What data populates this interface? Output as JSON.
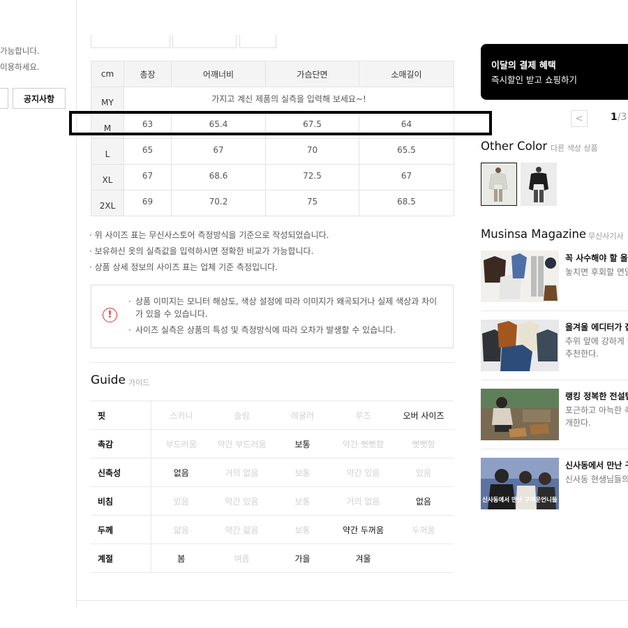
{
  "left_panel": {
    "note_line1": "가능합니다.",
    "note_line2": "이용하세요.",
    "notice_button": "공지사항"
  },
  "size_table": {
    "headers": [
      "cm",
      "총장",
      "어깨너비",
      "가슴단면",
      "소매길이"
    ],
    "my_label": "MY",
    "my_prompt": "가지고 계신 제품의 실측을 입력해 보세요~!",
    "rows": [
      {
        "size": "M",
        "values": [
          "63",
          "65.4",
          "67.5",
          "64"
        ]
      },
      {
        "size": "L",
        "values": [
          "65",
          "67",
          "70",
          "65.5"
        ]
      },
      {
        "size": "XL",
        "values": [
          "67",
          "68.6",
          "72.5",
          "67"
        ]
      },
      {
        "size": "2XL",
        "values": [
          "69",
          "70.2",
          "75",
          "68.5"
        ]
      }
    ],
    "highlighted_row": "M"
  },
  "bullets": [
    "위 사이즈 표는 무신사스토어 측정방식을 기준으로 작성되었습니다.",
    "보유하신 옷의 실측값을 입력하시면 정확한 비교가 가능합니다.",
    "상품 상세 정보의 사이즈 표는 업체 기준 측정입니다."
  ],
  "notice": {
    "icon": "exclamation-circle-icon",
    "icon_glyph": "!",
    "items": [
      "상품 이미지는 모니터 해상도, 색상 설정에 따라 이미지가 왜곡되거나 실제 색상과 차이가 있을 수 있습니다.",
      "사이즈 실측은 상품의 특성 및 측정방식에 따라 오차가 발생할 수 있습니다."
    ]
  },
  "guide": {
    "title": "Guide",
    "subtitle": "가이드",
    "rows": [
      {
        "label": "핏",
        "options": [
          "스키니",
          "슬림",
          "레귤러",
          "루즈",
          "오버 사이즈"
        ],
        "selected": [
          4
        ]
      },
      {
        "label": "촉감",
        "options": [
          "부드러움",
          "약간 부드러움",
          "보통",
          "약간 뻣뻣함",
          "뻣뻣함"
        ],
        "selected": [
          2
        ]
      },
      {
        "label": "신축성",
        "options": [
          "없음",
          "거의 없음",
          "보통",
          "약간 있음",
          "있음"
        ],
        "selected": [
          0
        ]
      },
      {
        "label": "비침",
        "options": [
          "있음",
          "약간 있음",
          "보통",
          "거의 없음",
          "없음"
        ],
        "selected": [
          4
        ]
      },
      {
        "label": "두께",
        "options": [
          "얇음",
          "약간 얇음",
          "보통",
          "약간 두꺼움",
          "두꺼움"
        ],
        "selected": [
          3
        ]
      },
      {
        "label": "계절",
        "options": [
          "봄",
          "여름",
          "가을",
          "겨울",
          ""
        ],
        "selected": [
          0,
          2,
          3
        ]
      }
    ]
  },
  "benefit_banner": {
    "title": "이달의 결제 혜택",
    "subtitle": "즉시할인 받고 쇼핑하기",
    "background": "#000000"
  },
  "pager": {
    "prev_icon": "chevron-left-icon",
    "prev_glyph": "<",
    "current": "1",
    "separator": "/",
    "total": "3"
  },
  "other_color": {
    "title": "Other Color",
    "subtitle": "다른 색상 상품",
    "items": [
      {
        "name": "light-gray-jacket",
        "color": "#d9dbd5",
        "selected": true
      },
      {
        "name": "black-jacket",
        "color": "#1e1e1e",
        "selected": false
      }
    ]
  },
  "magazine": {
    "title": "Musinsa Magazine",
    "subtitle": "무신사기사",
    "articles": [
      {
        "title": "꼭 사수해야 할 올해",
        "desc": [
          "놓치면 후회할 연말"
        ]
      },
      {
        "title": "올겨울 에디터가 잡",
        "desc": [
          "추위 앞에 강하게 맞",
          "추천한다."
        ]
      },
      {
        "title": "랭킹 정복한 전설템",
        "desc": [
          "포근하고 아늑한 촉",
          "개한다."
        ]
      },
      {
        "title": "신사동에서 만난 구",
        "desc": [
          "신사동 현생님들의"
        ],
        "image_caption": "신사동에서 만난 구여운언니들"
      }
    ]
  }
}
